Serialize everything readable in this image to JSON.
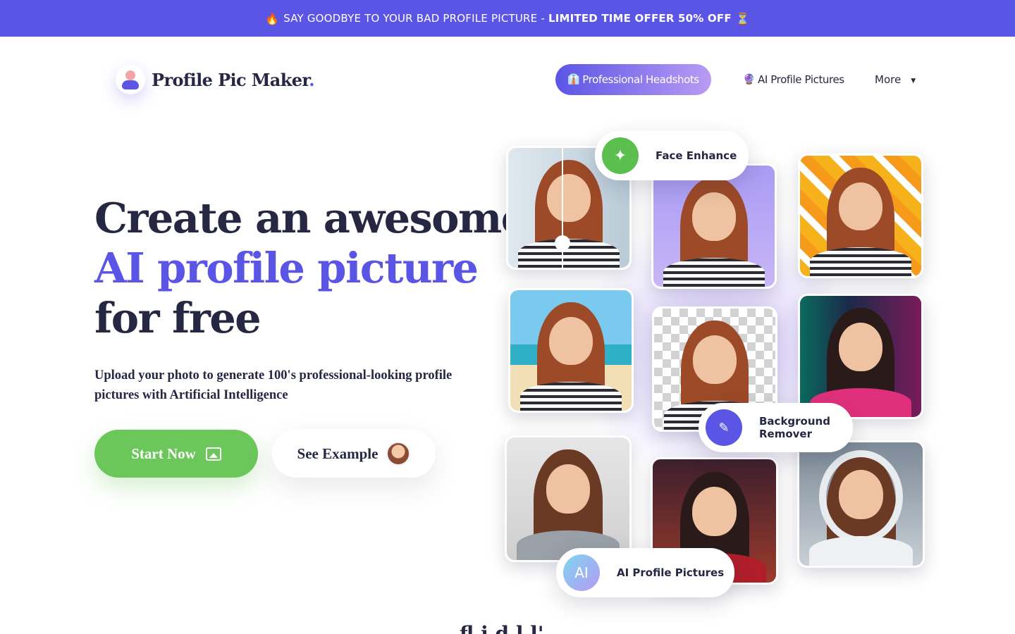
{
  "banner": {
    "fire_emoji": "🔥",
    "text": "SAY GOODBYE TO YOUR BAD PROFILE PICTURE -",
    "offer": "LIMITED TIME OFFER 50% OFF",
    "hourglass_emoji": "⏳"
  },
  "logo": {
    "text": "Profile Pic Maker",
    "dot": "."
  },
  "nav": {
    "headshots_icon": "👔",
    "headshots": "Professional Headshots",
    "ai_pictures_icon": "🔮",
    "ai_pictures": "AI Profile Pictures",
    "more": "More",
    "more_caret": "▼"
  },
  "hero": {
    "line1": "Create an awesome",
    "line2": "AI profile picture",
    "line3": "for free",
    "subtitle": "Upload your photo to generate 100's professional-looking profile pictures with Artificial Intelligence",
    "start_button": "Start Now",
    "example_button": "See Example"
  },
  "features": {
    "face_enhance": "Face Enhance",
    "face_enhance_icon": "✦",
    "background_remover": "Background Remover",
    "background_remover_icon": "✎",
    "ai_profile_pictures": "AI Profile Pictures",
    "ai_badge": "AI"
  },
  "section_heading": "fl i   d l   l'"
}
